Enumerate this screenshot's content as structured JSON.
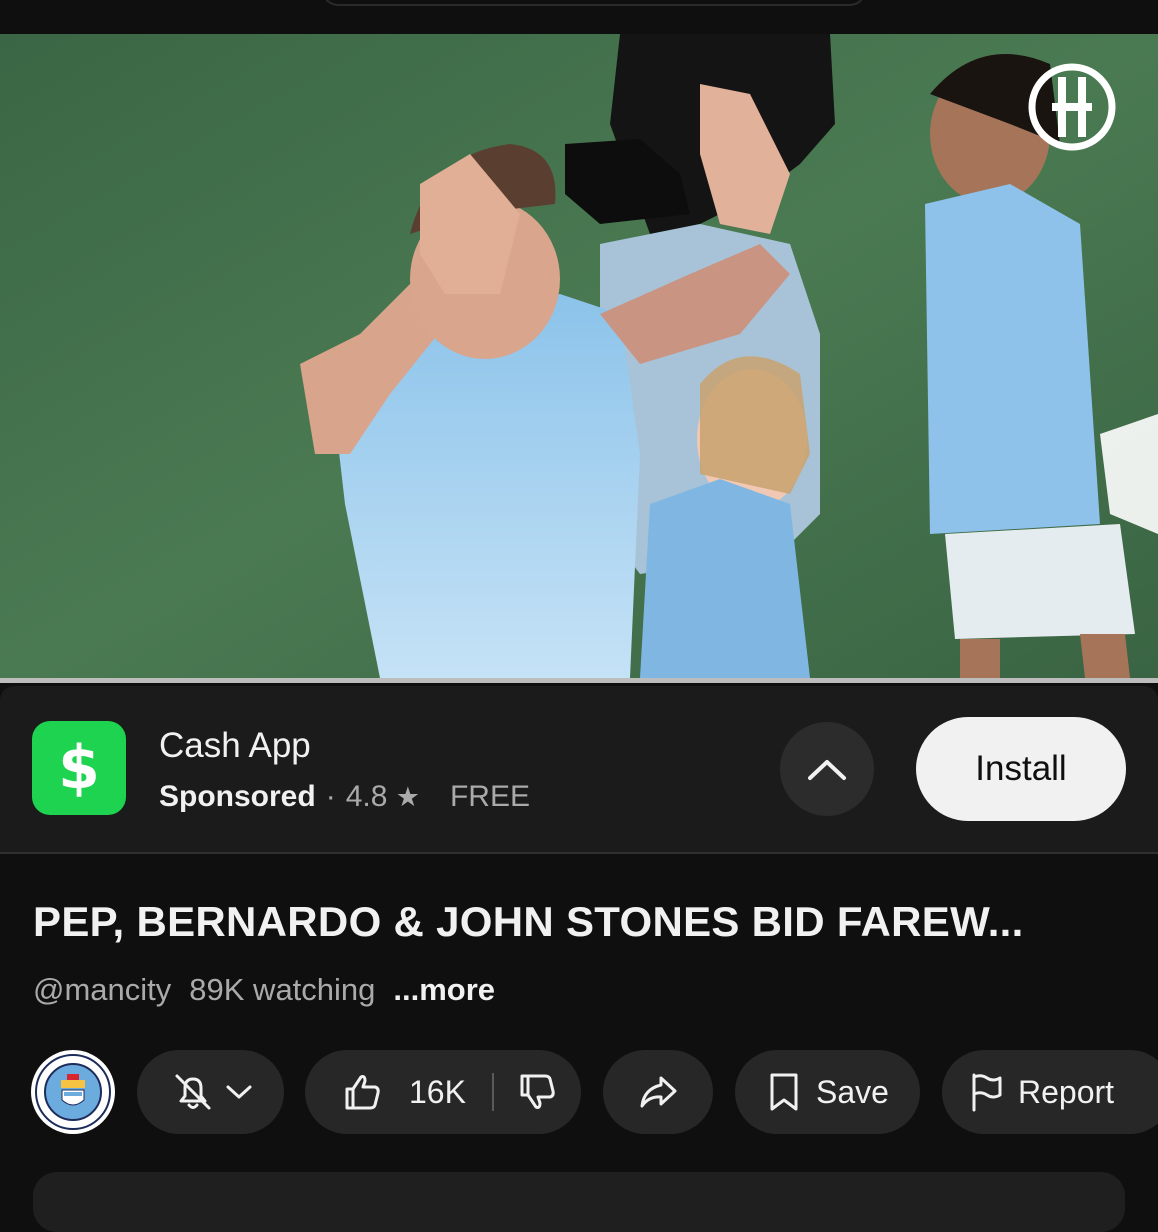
{
  "video": {
    "channel_watermark": "CITY",
    "progress": 1.0
  },
  "ad": {
    "app_name": "Cash App",
    "icon_symbol": "$",
    "icon_color": "#1ed34f",
    "sponsored_label": "Sponsored",
    "separator": "·",
    "rating": "4.8",
    "rating_icon": "★",
    "price": "FREE",
    "install_label": "Install",
    "expand_icon": "chevron-up-icon"
  },
  "video_info": {
    "title": "PEP, BERNARDO & JOHN STONES BID FAREW...",
    "channel_handle": "@mancity",
    "watching": "89K watching",
    "more_label": "...more"
  },
  "actions": {
    "channel_avatar": "Manchester City crest",
    "notifications_icon": "bell-off-icon",
    "like_count": "16K",
    "save_label": "Save",
    "report_label": "Report"
  },
  "colors": {
    "background": "#0f0f0f",
    "pill": "#272727",
    "ad_card": "#1b1b1b"
  }
}
